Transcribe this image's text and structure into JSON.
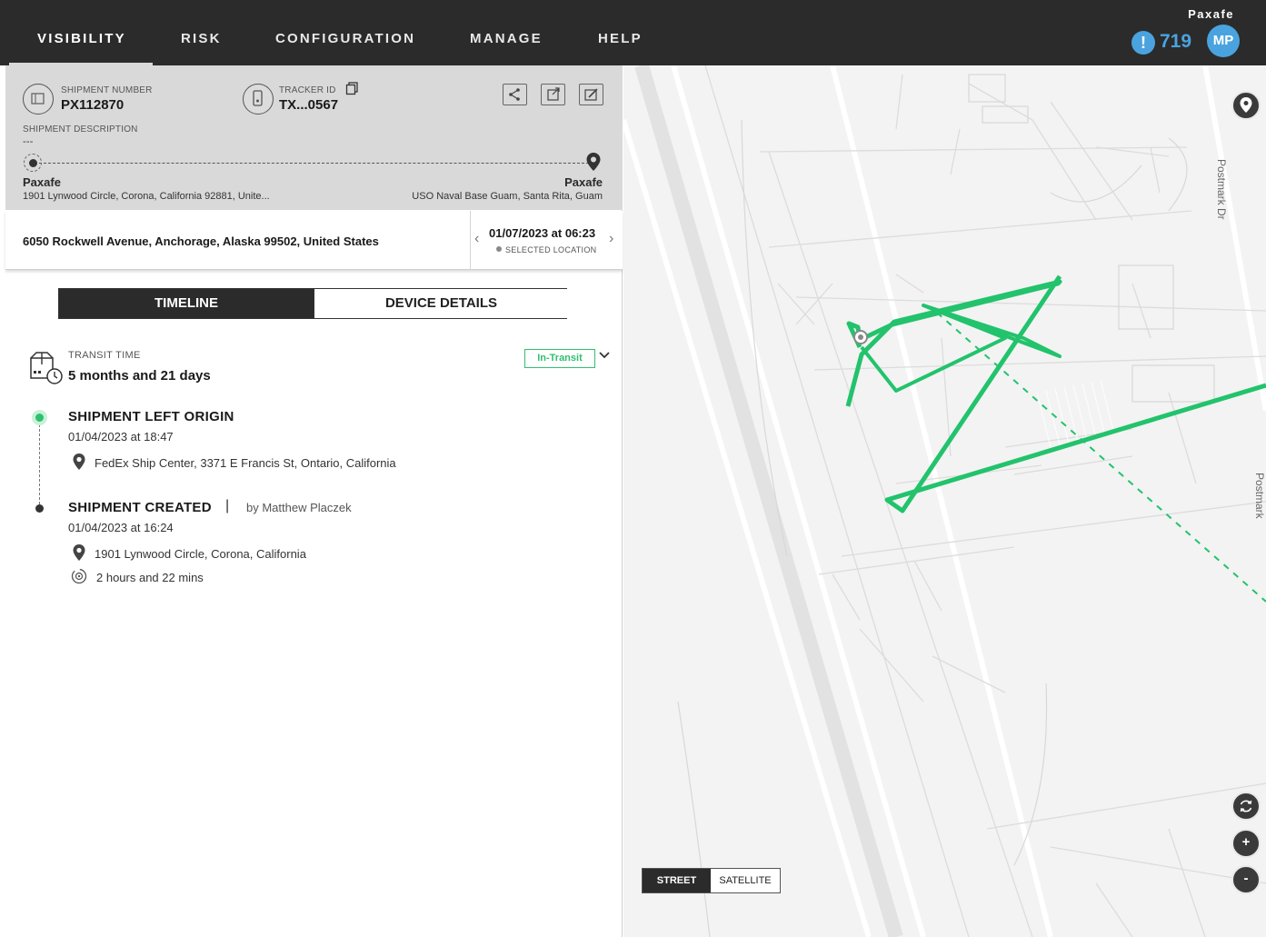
{
  "nav": {
    "items": [
      "VISIBILITY",
      "RISK",
      "CONFIGURATION",
      "MANAGE",
      "HELP"
    ],
    "brand": "Paxafe",
    "alert_count": "719",
    "avatar_initials": "MP",
    "accent": "#4aa3df"
  },
  "shipment": {
    "number_label": "SHIPMENT NUMBER",
    "number": "PX112870",
    "tracker_label": "TRACKER ID",
    "tracker": "TX...0567",
    "description_label": "SHIPMENT DESCRIPTION",
    "description": "---",
    "origin_name": "Paxafe",
    "origin_address": "1901 Lynwood Circle, Corona, California 92881, Unite...",
    "dest_name": "Paxafe",
    "dest_address": "USO Naval Base Guam, Santa Rita, Guam"
  },
  "selected_location": {
    "address": "6050 Rockwell Avenue, Anchorage, Alaska 99502, United States",
    "datetime": "01/07/2023 at 06:23",
    "caption": "SELECTED LOCATION"
  },
  "tabs": [
    "TIMELINE",
    "DEVICE DETAILS"
  ],
  "transit": {
    "label": "TRANSIT TIME",
    "value": "5 months and 21 days",
    "status": "In-Transit",
    "status_color": "#2fc06e"
  },
  "events": [
    {
      "title": "SHIPMENT LEFT ORIGIN",
      "date": "01/04/2023 at 18:47",
      "location": "FedEx Ship Center, 3371 E Francis St, Ontario, California"
    },
    {
      "title": "SHIPMENT CREATED",
      "separator": "|",
      "by": "by Matthew Placzek",
      "date": "01/04/2023 at 16:24",
      "location": "1901 Lynwood Circle, Corona, California",
      "duration": "2 hours and 22 mins"
    }
  ],
  "map": {
    "street_labels": [
      "Postmark Dr",
      "Postmark"
    ],
    "toggle": [
      "STREET",
      "SATELLITE"
    ],
    "route_color": "#22c36c"
  }
}
